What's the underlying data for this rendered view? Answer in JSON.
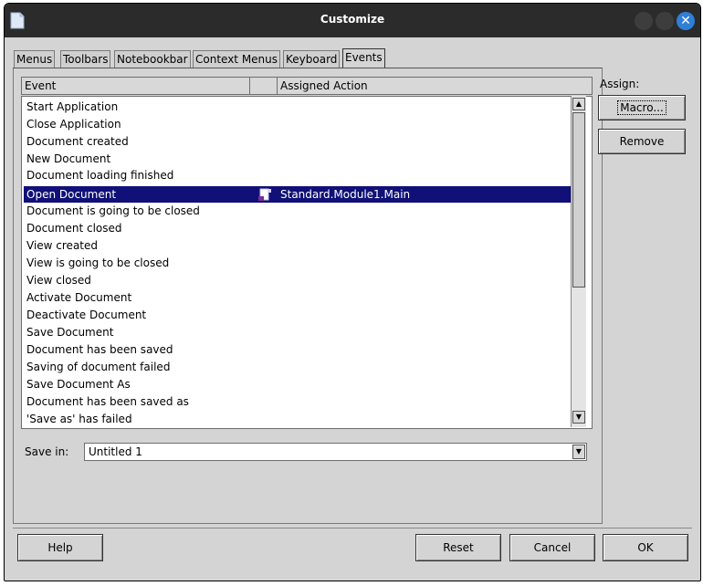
{
  "window": {
    "title": "Customize"
  },
  "tabs": [
    {
      "label": "Menus",
      "active": false
    },
    {
      "label": "Toolbars",
      "active": false
    },
    {
      "label": "Notebookbar",
      "active": false
    },
    {
      "label": "Context Menus",
      "active": false
    },
    {
      "label": "Keyboard",
      "active": false
    },
    {
      "label": "Events",
      "active": true
    }
  ],
  "events_table": {
    "columns": [
      "Event",
      "Assigned Action"
    ],
    "rows": [
      {
        "event": "Start Application",
        "action": ""
      },
      {
        "event": "Close Application",
        "action": ""
      },
      {
        "event": "Document created",
        "action": ""
      },
      {
        "event": "New Document",
        "action": ""
      },
      {
        "event": "Document loading finished",
        "action": ""
      },
      {
        "event": "Open Document",
        "action": "Standard.Module1.Main",
        "selected": true
      },
      {
        "event": "Document is going to be closed",
        "action": ""
      },
      {
        "event": "Document closed",
        "action": ""
      },
      {
        "event": "View created",
        "action": ""
      },
      {
        "event": "View is going to be closed",
        "action": ""
      },
      {
        "event": "View closed",
        "action": ""
      },
      {
        "event": "Activate Document",
        "action": ""
      },
      {
        "event": "Deactivate Document",
        "action": ""
      },
      {
        "event": "Save Document",
        "action": ""
      },
      {
        "event": "Document has been saved",
        "action": ""
      },
      {
        "event": "Saving of document failed",
        "action": ""
      },
      {
        "event": "Save Document As",
        "action": ""
      },
      {
        "event": "Document has been saved as",
        "action": ""
      },
      {
        "event": "'Save as' has failed",
        "action": ""
      }
    ]
  },
  "assign": {
    "label": "Assign:",
    "macro_button": "Macro...",
    "remove_button": "Remove"
  },
  "save_in": {
    "label": "Save in:",
    "value": "Untitled 1"
  },
  "footer": {
    "help": "Help",
    "reset": "Reset",
    "cancel": "Cancel",
    "ok": "OK"
  },
  "colors": {
    "selection": "#101078",
    "titlebar": "#2b2b2b",
    "close_button": "#2f7fd8"
  }
}
